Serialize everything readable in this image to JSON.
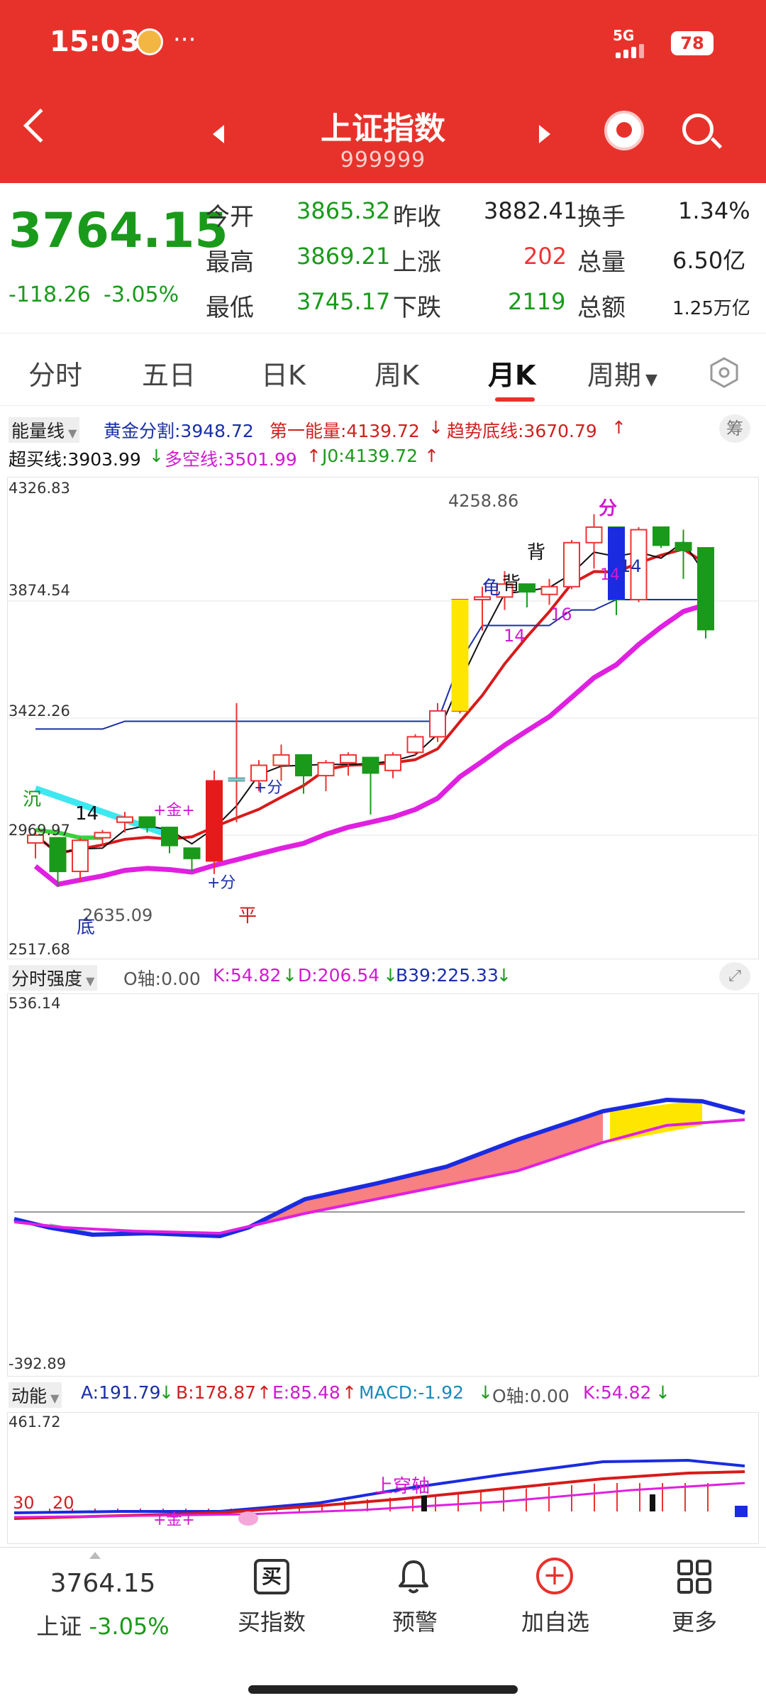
{
  "status": {
    "time": "15:03",
    "network": "5G",
    "battery": "78"
  },
  "header": {
    "title": "上证指数",
    "code": "999999"
  },
  "quote": {
    "price": "3764.15",
    "change": "-118.26",
    "change_pct": "-3.05%",
    "open_label": "今开",
    "open": "3865.32",
    "prev_label": "昨收",
    "prev": "3882.41",
    "turnover_label": "换手",
    "turnover": "1.34%",
    "high_label": "最高",
    "high": "3869.21",
    "up_label": "上涨",
    "up": "202",
    "volume_label": "总量",
    "volume": "6.50亿",
    "low_label": "最低",
    "low": "3745.17",
    "down_label": "下跌",
    "down": "2119",
    "amount_label": "总额",
    "amount": "1.25万亿"
  },
  "tabs": [
    {
      "label": "分时"
    },
    {
      "label": "五日"
    },
    {
      "label": "日K"
    },
    {
      "label": "周K"
    },
    {
      "label": "月K"
    },
    {
      "label": "周期"
    }
  ],
  "active_tab": "月K",
  "legend1": {
    "indicator": "能量线",
    "gold": "黄金分割:3948.72",
    "energy1": "第一能量:4139.72",
    "trend": "趋势底线:3670.79",
    "right_btn": "筹"
  },
  "legend2": {
    "overbuy": "超买线:3903.99",
    "longshort": "多空线:3501.99",
    "j0": "J0:4139.72"
  },
  "kchart": {
    "y_labels": [
      "4326.83",
      "3874.54",
      "3422.26",
      "2969.97",
      "2517.68"
    ],
    "annotations": {
      "max": "4258.86",
      "min": "2635.09",
      "fen": "分",
      "bei1": "背",
      "bei2": "背",
      "gui": "龟",
      "n14a": "14",
      "n14b": "14",
      "n14c": "14",
      "n14d": "14",
      "n16": "16",
      "chen": "沉",
      "di": "底",
      "ping": "平",
      "jin": "+金+",
      "fen2": "+分",
      "fen3": "+分"
    }
  },
  "panel2": {
    "indicator": "分时强度",
    "o_axis": "O轴:0.00",
    "k": "K:54.82",
    "d": "D:206.54",
    "b39": "B39:225.33",
    "y_top": "536.14",
    "y_bottom": "-392.89"
  },
  "panel3": {
    "indicator": "动能",
    "a": "A:191.79",
    "b": "B:178.87",
    "e": "E:85.48",
    "macd": "MACD:-1.92",
    "o_axis": "O轴:0.00",
    "k": "K:54.82",
    "y_top": "461.72",
    "n30": "30",
    "n20": "20",
    "cross": "上穿轴",
    "jin": "+金+"
  },
  "bottom_nav": {
    "price": "3764.15",
    "name": "上证",
    "pct": "-3.05%",
    "buy_icon_text": "买",
    "buy": "买指数",
    "alert": "预警",
    "add": "加自选",
    "more": "更多"
  },
  "chart_data": {
    "type": "candlestick",
    "ylim": [
      2517.68,
      4326.83
    ],
    "note_series": [
      "K线",
      "黄金分割",
      "第一能量",
      "趋势底线",
      "超买线",
      "多空线"
    ],
    "candles": [
      [
        2940,
        2990,
        2880,
        2970
      ],
      [
        2960,
        2930,
        2770,
        2830
      ],
      [
        2830,
        2960,
        2790,
        2950
      ],
      [
        2960,
        2990,
        2930,
        2980
      ],
      [
        3020,
        3060,
        2980,
        3040
      ],
      [
        3040,
        3010,
        2980,
        3000
      ],
      [
        3000,
        2950,
        2900,
        2930
      ],
      [
        2920,
        2860,
        2830,
        2880
      ],
      [
        2870,
        3220,
        2820,
        3180
      ],
      [
        3180,
        3480,
        3020,
        3190
      ],
      [
        3180,
        3260,
        3140,
        3240
      ],
      [
        3240,
        3320,
        3180,
        3280
      ],
      [
        3280,
        3180,
        3130,
        3200
      ],
      [
        3200,
        3260,
        3140,
        3250
      ],
      [
        3250,
        3290,
        3200,
        3280
      ],
      [
        3270,
        3240,
        3050,
        3210
      ],
      [
        3220,
        3290,
        3190,
        3280
      ],
      [
        3290,
        3360,
        3280,
        3350
      ],
      [
        3350,
        3480,
        3330,
        3450
      ],
      [
        3450,
        3880,
        3440,
        3880
      ],
      [
        3880,
        3930,
        3760,
        3890
      ],
      [
        3890,
        3990,
        3840,
        3940
      ],
      [
        3940,
        3880,
        3850,
        3910
      ],
      [
        3900,
        3960,
        3860,
        3930
      ],
      [
        3930,
        4110,
        3920,
        4100
      ],
      [
        4100,
        4210,
        4000,
        4160
      ],
      [
        4160,
        3880,
        3820,
        3880
      ],
      [
        3880,
        4160,
        3870,
        4150
      ],
      [
        4160,
        4120,
        4080,
        4090
      ],
      [
        4100,
        4150,
        3960,
        4070
      ],
      [
        4080,
        3740,
        3730,
        3764
      ]
    ],
    "gold_split": 3948.72,
    "energy1": 4139.72,
    "trend_base": 3670.79,
    "overbuy": 3903.99,
    "long_short": 3501.99
  }
}
